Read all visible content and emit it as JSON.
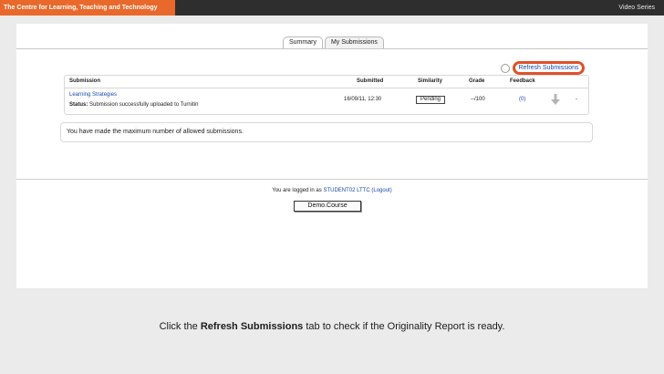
{
  "header": {
    "brand": "The Centre for Learning, Teaching and Technology",
    "series": "Video Series",
    "brand_color": "#e8692b",
    "bar_color": "#2e2e2e"
  },
  "tabs": [
    {
      "label": "Summary"
    },
    {
      "label": "My Submissions"
    }
  ],
  "refresh": {
    "label": "Refresh Submissions",
    "highlight_color": "#e0502a",
    "icon": "refresh-icon"
  },
  "table": {
    "headers": [
      "Submission",
      "Submitted",
      "Similarity",
      "Grade",
      "Feedback"
    ],
    "row": {
      "title": "Learning Strategies",
      "status_label": "Status:",
      "status_text": "Submission successfully uploaded to Turnitin",
      "submitted": "16/09/11, 12:30",
      "similarity": "Pending",
      "grade": "--/100",
      "feedback": "(0)",
      "download_icon": "download-arrow-icon",
      "dash": "-"
    }
  },
  "notice": "You have made the maximum number of allowed submissions.",
  "login": {
    "prefix": "You are logged in as",
    "user": "STUDENT02 LTTC",
    "logout": "(Logout)"
  },
  "course_button": "Demo.Course",
  "caption": {
    "before": "Click the",
    "bold": "Refresh Submissions",
    "after": "tab to check if the Originality Report is ready."
  }
}
